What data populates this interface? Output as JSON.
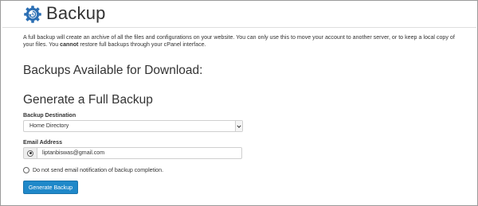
{
  "page": {
    "title": "Backup",
    "icon": "backup-gear-icon",
    "accent_color": "#1f88c9"
  },
  "description": {
    "line1": "A full backup will create an archive of all the files and configurations on your website. You can only use this to move your account to another server, or to keep a local copy of",
    "line2_prefix": "your files. You",
    "line2_bold": "cannot",
    "line2_suffix": "restore full backups through your cPanel interface."
  },
  "sections": {
    "available_heading": "Backups Available for Download:",
    "generate_heading": "Generate a Full Backup"
  },
  "form": {
    "destination_label": "Backup Destination",
    "destination_value": "Home Directory",
    "email_label": "Email Address",
    "email_value": "liptanbiswas@gmail.com",
    "email_selected": true,
    "no_email_option": "Do not send email notification of backup completion.",
    "no_email_selected": false,
    "submit_label": "Generate Backup"
  }
}
